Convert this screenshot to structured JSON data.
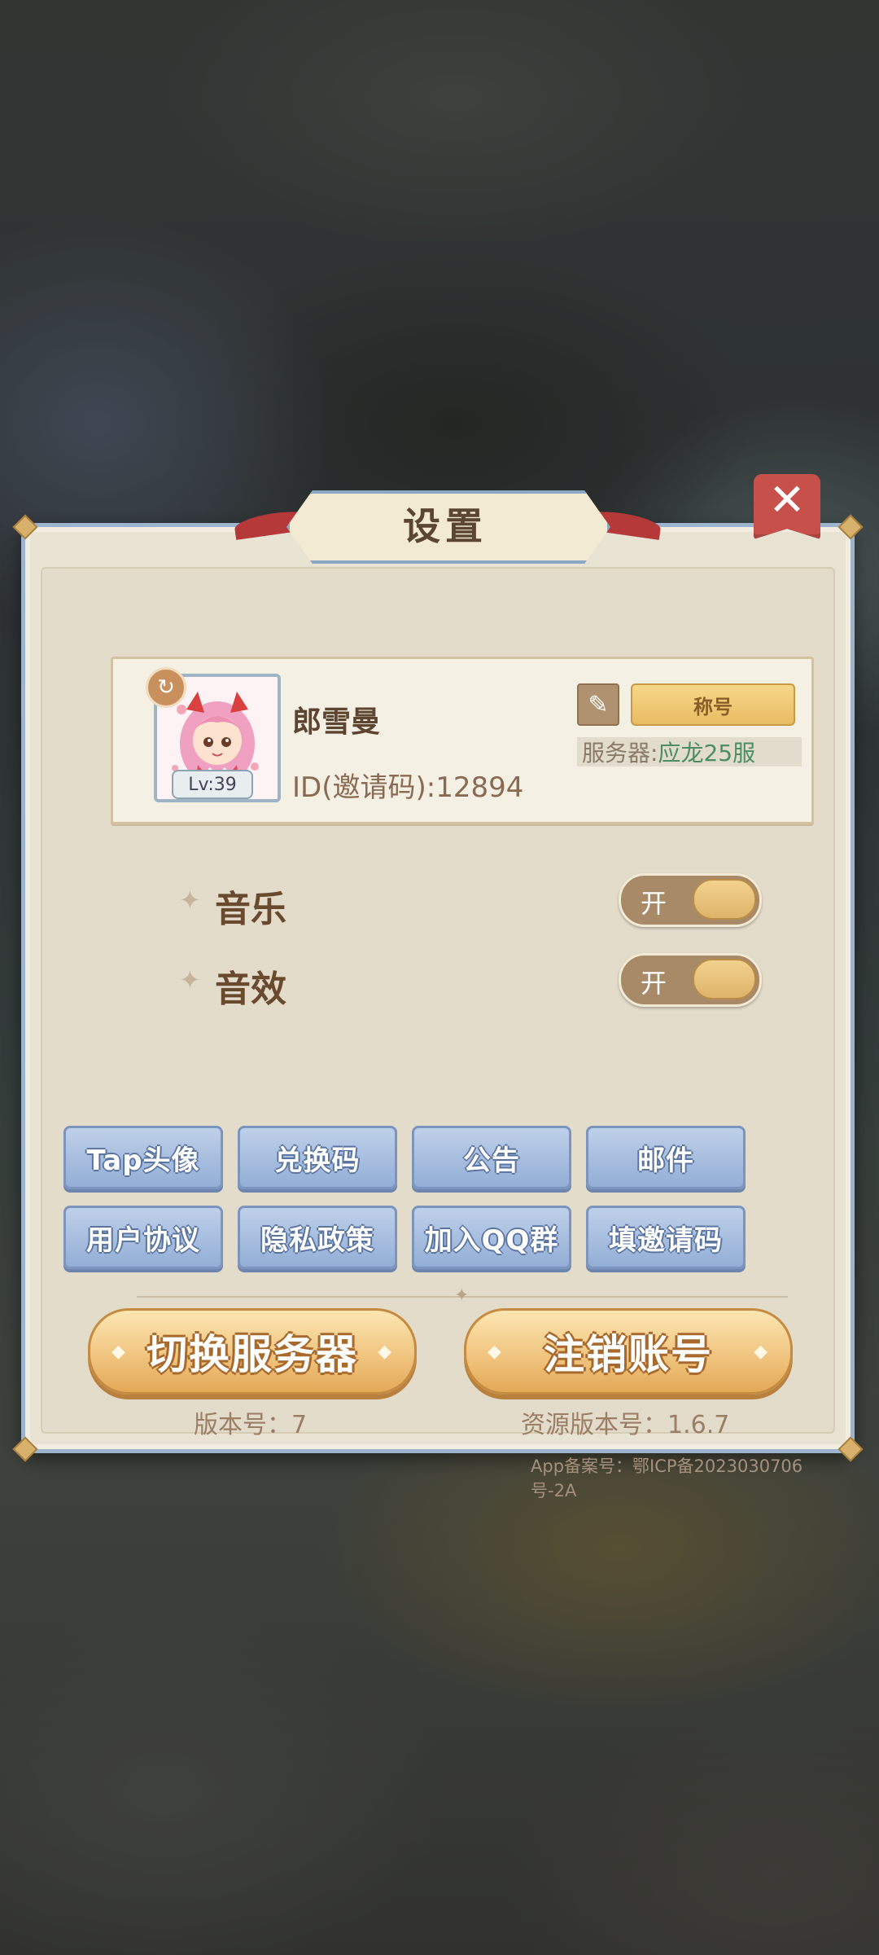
{
  "dialog": {
    "title": "设置",
    "close_icon": "close-icon"
  },
  "profile": {
    "name": "郎雪曼",
    "id_text": "ID(邀请码):12894",
    "level": "Lv:39",
    "edit_icon": "pencil-icon",
    "refresh_icon": "refresh-icon",
    "title_button": "称号",
    "server_label": "服务器: ",
    "server_value": "应龙25服"
  },
  "settings": [
    {
      "label": "音乐",
      "state": "开",
      "on": true
    },
    {
      "label": "音效",
      "state": "开",
      "on": true
    }
  ],
  "buttons": [
    "Tap头像",
    "兑换码",
    "公告",
    "邮件",
    "用户协议",
    "隐私政策",
    "加入QQ群",
    "填邀请码"
  ],
  "actions": {
    "switch_server": "切换服务器",
    "cancel_account": "注销账号"
  },
  "footer": {
    "version": "版本号：7",
    "resource_version": "资源版本号：1.6.7",
    "icp": "App备案号：鄂ICP备2023030706号-2A"
  },
  "colors": {
    "panel": "#e4dccb",
    "frame": "#9db4cf",
    "blue_button": "#93aed6",
    "gold_button": "#efc27c",
    "close": "#c8504a"
  }
}
